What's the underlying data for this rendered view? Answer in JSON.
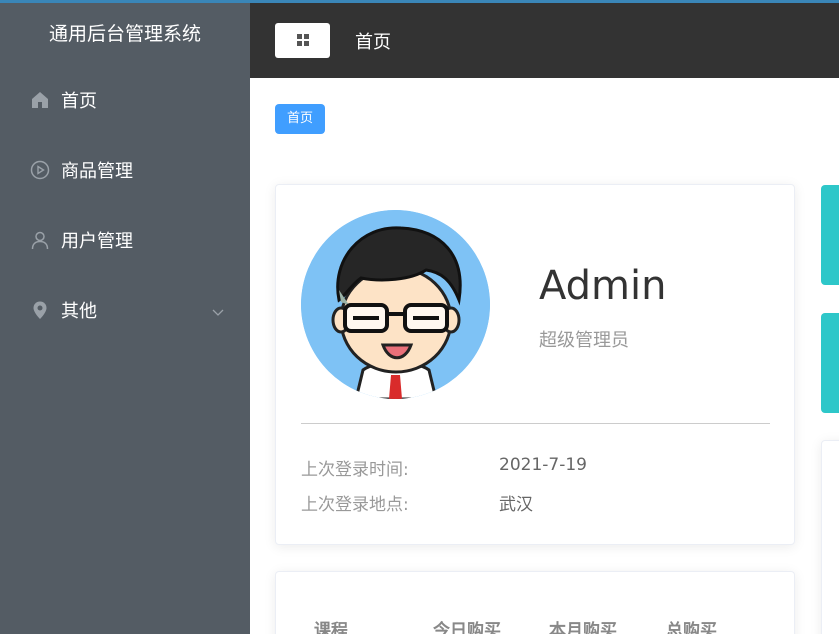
{
  "app": {
    "title": "通用后台管理系统"
  },
  "sidebar": {
    "items": [
      {
        "label": "首页",
        "icon": "home-icon"
      },
      {
        "label": "商品管理",
        "icon": "video-play-icon"
      },
      {
        "label": "用户管理",
        "icon": "user-icon"
      },
      {
        "label": "其他",
        "icon": "location-icon"
      }
    ]
  },
  "header": {
    "toggle_icon": "grid-menu-icon",
    "title": "首页"
  },
  "breadcrumb": {
    "tag": "首页"
  },
  "user": {
    "name": "Admin",
    "role": "超级管理员",
    "last_login_time_label": "上次登录时间:",
    "last_login_time": "2021-7-19",
    "last_login_location_label": "上次登录地点:",
    "last_login_location": "武汉"
  },
  "table": {
    "headers": [
      "课程",
      "今日购买",
      "本月购买",
      "总购买"
    ]
  },
  "colors": {
    "sidebar_bg": "#545c64",
    "header_bg": "#333333",
    "primary": "#409eff",
    "teal": "#2ec7c9"
  }
}
